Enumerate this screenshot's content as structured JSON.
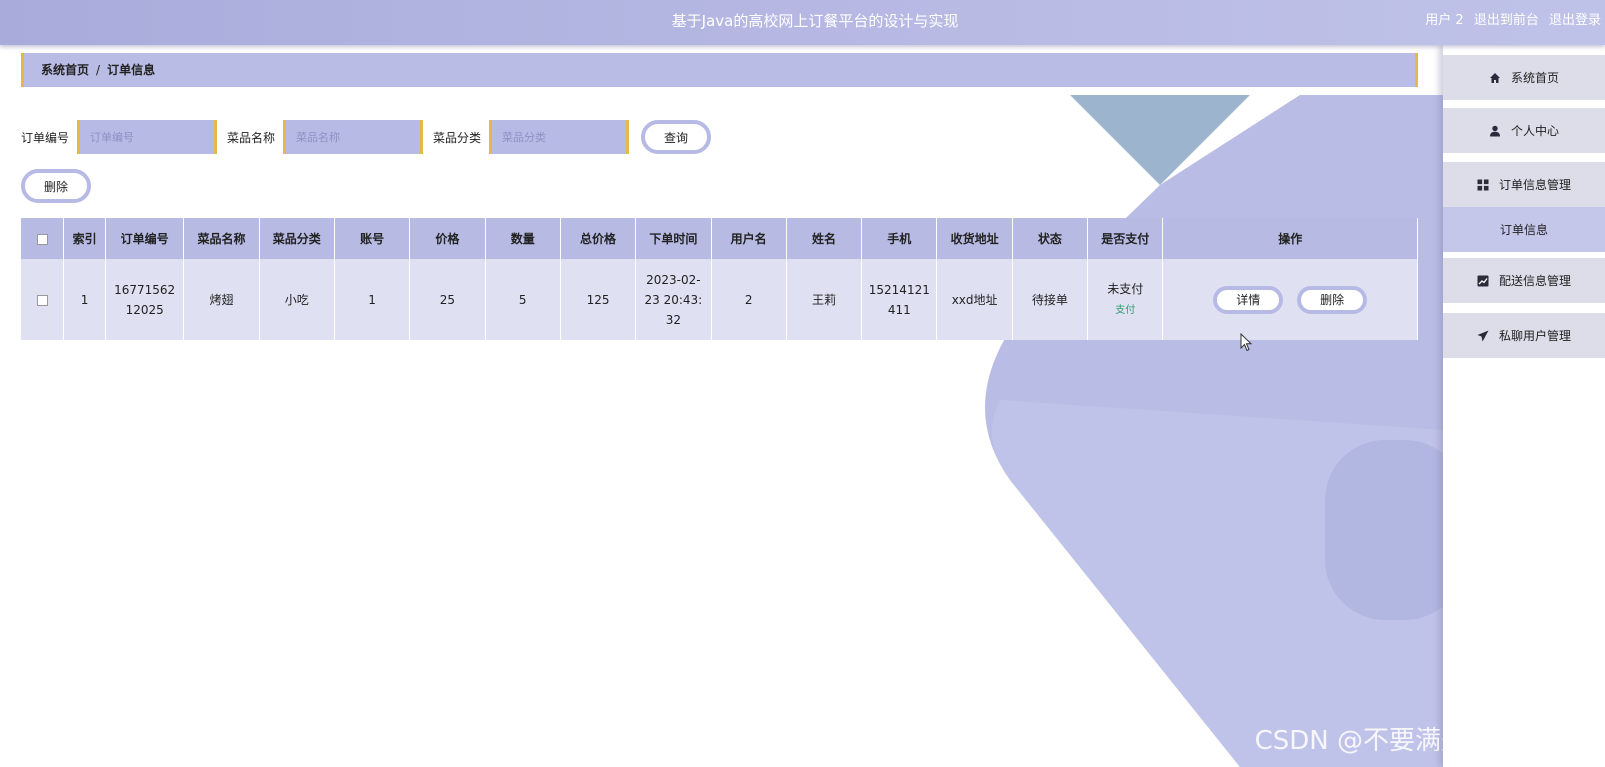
{
  "header": {
    "title": "基于Java的高校网上订餐平台的设计与实现",
    "user_label": "用户 2",
    "to_front_label": "退出到前台",
    "logout_label": "退出登录"
  },
  "breadcrumb": {
    "home": "系统首页",
    "separator": "/",
    "current": "订单信息"
  },
  "search": {
    "order_no_label": "订单编号",
    "order_no_placeholder": "订单编号",
    "dish_name_label": "菜品名称",
    "dish_name_placeholder": "菜品名称",
    "dish_category_label": "菜品分类",
    "dish_category_placeholder": "菜品分类",
    "query_button": "查询"
  },
  "actions": {
    "batch_delete_button": "删除"
  },
  "table": {
    "headers": [
      "",
      "索引",
      "订单编号",
      "菜品名称",
      "菜品分类",
      "账号",
      "价格",
      "数量",
      "总价格",
      "下单时间",
      "用户名",
      "姓名",
      "手机",
      "收货地址",
      "状态",
      "是否支付",
      "操作"
    ],
    "rows": [
      {
        "index": "1",
        "order_no_line1": "16771562",
        "order_no_line2": "12025",
        "dish_name": "烤翅",
        "dish_category": "小吃",
        "account": "1",
        "price": "25",
        "quantity": "5",
        "total_price": "125",
        "order_time_line1": "2023-02-",
        "order_time_line2": "23 20:43:",
        "order_time_line3": "32",
        "username": "2",
        "name": "王莉",
        "phone_line1": "15214121",
        "phone_line2": "411",
        "address": "xxd地址",
        "status": "待接单",
        "paid_status": "未支付",
        "pay_link": "支付",
        "detail_button": "详情",
        "delete_button": "删除"
      }
    ]
  },
  "sidebar": {
    "items": [
      {
        "label": "系统首页",
        "icon": "home-icon"
      },
      {
        "label": "个人中心",
        "icon": "user-icon"
      },
      {
        "label": "订单信息管理",
        "icon": "grid-icon"
      },
      {
        "label": "订单信息",
        "icon": ""
      },
      {
        "label": "配送信息管理",
        "icon": "chart-icon"
      },
      {
        "label": "私聊用户管理",
        "icon": "send-icon"
      }
    ]
  },
  "watermark": "CSDN @不要满是遗憾的离开",
  "colors": {
    "header_bg": "#b6b8e3",
    "accent_border": "#e5b84a",
    "table_header_bg": "#b7bae3",
    "pay_link": "#2d9b6a"
  }
}
